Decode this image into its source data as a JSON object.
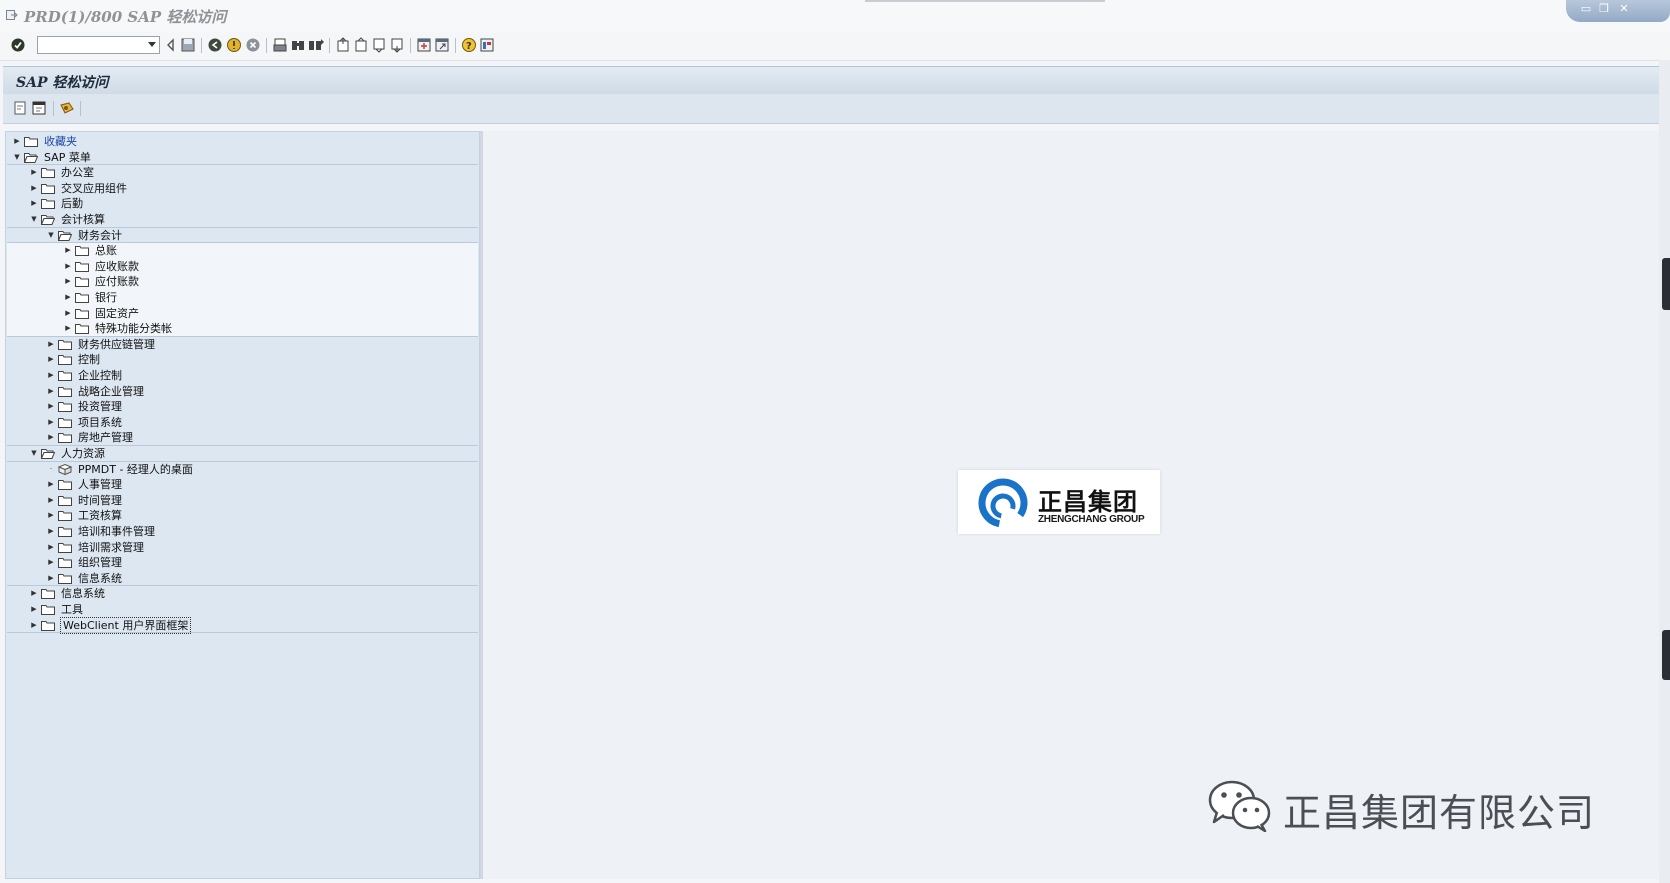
{
  "window": {
    "title": "PRD(1)/800 SAP 轻松访问",
    "controls": [
      "minimize-icon",
      "maximize-icon",
      "close-icon"
    ]
  },
  "system_toolbar": {
    "command_field": {
      "value": "",
      "placeholder": ""
    },
    "icons": [
      "enter-icon",
      "back-icon",
      "save-icon",
      "back-navigation-icon",
      "exit-icon",
      "cancel-icon",
      "print-icon",
      "find-icon",
      "find-next-icon",
      "first-page-icon",
      "previous-page-icon",
      "next-page-icon",
      "last-page-icon",
      "create-session-icon",
      "shortcut-icon",
      "help-icon",
      "layout-menu-icon"
    ]
  },
  "screen": {
    "title": "SAP 轻松访问",
    "app_icons": [
      "add-favorite-icon",
      "change-favorite-icon",
      "other-menu-icon"
    ]
  },
  "tree": [
    {
      "label": "收藏夹",
      "level": 0,
      "state": "collapsed",
      "kind": "favorites"
    },
    {
      "label": "SAP 菜单",
      "level": 0,
      "state": "expanded",
      "kind": "folder"
    },
    {
      "label": "办公室",
      "level": 1,
      "state": "collapsed",
      "kind": "folder"
    },
    {
      "label": "交叉应用组件",
      "level": 1,
      "state": "collapsed",
      "kind": "folder"
    },
    {
      "label": "后勤",
      "level": 1,
      "state": "collapsed",
      "kind": "folder"
    },
    {
      "label": "会计核算",
      "level": 1,
      "state": "expanded",
      "kind": "folder"
    },
    {
      "label": "财务会计",
      "level": 2,
      "state": "expanded",
      "kind": "folder"
    },
    {
      "label": "总账",
      "level": 3,
      "state": "collapsed",
      "kind": "folder"
    },
    {
      "label": "应收账款",
      "level": 3,
      "state": "collapsed",
      "kind": "folder"
    },
    {
      "label": "应付账款",
      "level": 3,
      "state": "collapsed",
      "kind": "folder"
    },
    {
      "label": "银行",
      "level": 3,
      "state": "collapsed",
      "kind": "folder"
    },
    {
      "label": "固定资产",
      "level": 3,
      "state": "collapsed",
      "kind": "folder"
    },
    {
      "label": "特殊功能分类帐",
      "level": 3,
      "state": "collapsed",
      "kind": "folder"
    },
    {
      "label": "财务供应链管理",
      "level": 2,
      "state": "collapsed",
      "kind": "folder"
    },
    {
      "label": "控制",
      "level": 2,
      "state": "collapsed",
      "kind": "folder"
    },
    {
      "label": "企业控制",
      "level": 2,
      "state": "collapsed",
      "kind": "folder"
    },
    {
      "label": "战略企业管理",
      "level": 2,
      "state": "collapsed",
      "kind": "folder"
    },
    {
      "label": "投资管理",
      "level": 2,
      "state": "collapsed",
      "kind": "folder"
    },
    {
      "label": "项目系统",
      "level": 2,
      "state": "collapsed",
      "kind": "folder"
    },
    {
      "label": "房地产管理",
      "level": 2,
      "state": "collapsed",
      "kind": "folder"
    },
    {
      "label": "人力资源",
      "level": 1,
      "state": "expanded",
      "kind": "folder"
    },
    {
      "label": "PPMDT - 经理人的桌面",
      "level": 2,
      "state": "leaf",
      "kind": "transaction"
    },
    {
      "label": "人事管理",
      "level": 2,
      "state": "collapsed",
      "kind": "folder"
    },
    {
      "label": "时间管理",
      "level": 2,
      "state": "collapsed",
      "kind": "folder"
    },
    {
      "label": "工资核算",
      "level": 2,
      "state": "collapsed",
      "kind": "folder"
    },
    {
      "label": "培训和事件管理",
      "level": 2,
      "state": "collapsed",
      "kind": "folder"
    },
    {
      "label": "培训需求管理",
      "level": 2,
      "state": "collapsed",
      "kind": "folder"
    },
    {
      "label": "组织管理",
      "level": 2,
      "state": "collapsed",
      "kind": "folder"
    },
    {
      "label": "信息系统",
      "level": 2,
      "state": "collapsed",
      "kind": "folder"
    },
    {
      "label": "信息系统",
      "level": 1,
      "state": "collapsed",
      "kind": "folder"
    },
    {
      "label": "工具",
      "level": 1,
      "state": "collapsed",
      "kind": "folder"
    },
    {
      "label": "WebClient 用户界面框架",
      "level": 1,
      "state": "collapsed",
      "kind": "folder",
      "focused": true
    }
  ],
  "logo": {
    "name_cn": "正昌集团",
    "name_en": "ZHENGCHANG GROUP",
    "color": "#1a73c9"
  },
  "watermark": {
    "text": "正昌集团有限公司"
  },
  "colors": {
    "tree_bg": "#dde7f1",
    "header_bg": "#cfdbe7",
    "link_blue": "#1c47a8"
  }
}
